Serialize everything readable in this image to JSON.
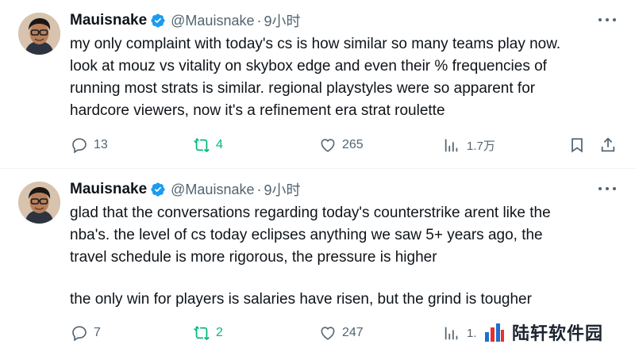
{
  "tweets": [
    {
      "author": {
        "name": "Mauisnake",
        "handle": "@Mauisnake",
        "separator": "·",
        "time": "9小时"
      },
      "text_lines": [
        "my only complaint with today's cs is how similar so many teams play now.",
        "look at mouz vs vitality on skybox edge and even their % frequencies of",
        "running most strats is similar. regional playstyles were so apparent for",
        "hardcore viewers, now it's a refinement era strat roulette"
      ],
      "metrics": {
        "replies": "13",
        "retweets": "4",
        "likes": "265",
        "views": "1.7万"
      }
    },
    {
      "author": {
        "name": "Mauisnake",
        "handle": "@Mauisnake",
        "separator": "·",
        "time": "9小时"
      },
      "text_lines_a": [
        "glad that the conversations regarding today's counterstrike arent like the",
        "nba's. the level of cs today eclipses anything we saw 5+ years ago, the",
        "travel schedule is more rigorous, the pressure is higher"
      ],
      "text_lines_b": [
        "the only win for players is salaries have risen, but the grind is tougher"
      ],
      "metrics": {
        "replies": "7",
        "retweets": "2",
        "likes": "247",
        "views": "1."
      }
    }
  ],
  "watermark": {
    "text": "陆轩软件园"
  },
  "colors": {
    "text": "#0f1419",
    "muted": "#536471",
    "verified": "#1d9bf0",
    "retweet": "#00ba7c",
    "divider": "#eff3f4"
  },
  "icons": [
    "reply-icon",
    "retweet-icon",
    "like-icon",
    "views-icon",
    "bookmark-icon",
    "share-icon",
    "more-icon",
    "verified-icon"
  ]
}
